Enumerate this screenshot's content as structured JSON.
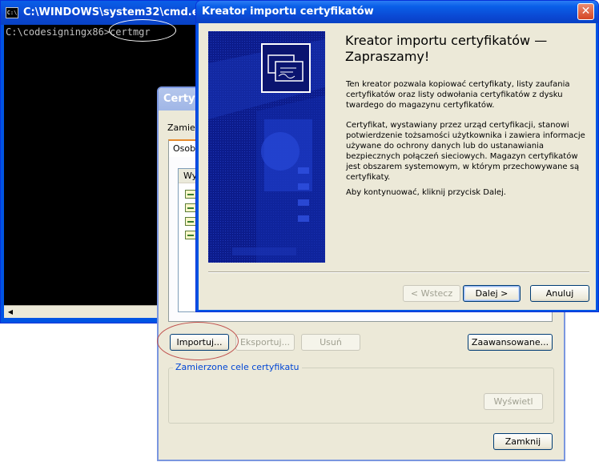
{
  "cmd": {
    "title": "C:\\WINDOWS\\system32\\cmd.exe - c",
    "icon_text": "C:\\",
    "line_prompt": "C:\\codesigningx86>",
    "line_command": "certmgr"
  },
  "certmgr": {
    "title": "Certyfi",
    "purpose_label": "Zamierz",
    "tab_label": "Osobis",
    "column_header": "Wy",
    "import_label": "Importuj...",
    "export_label": "Eksportuj...",
    "remove_label": "Usuń",
    "advanced_label": "Zaawansowane...",
    "purposes_group_label": "Zamierzone cele certyfikatu",
    "view_label": "Wyświetl",
    "close_label": "Zamknij"
  },
  "wizard": {
    "title": "Kreator importu certyfikatów",
    "close_glyph": "✕",
    "heading": "Kreator importu certyfikatów —\nZapraszamy!",
    "paragraph1": "Ten kreator pozwala kopiować certyfikaty, listy zaufania certyfikatów oraz listy odwołania certyfikatów z dysku twardego do magazynu certyfikatów.",
    "paragraph2": "Certyfikat, wystawiany przez urząd certyfikacji, stanowi potwierdzenie tożsamości użytkownika i zawiera informacje używane do ochrony danych lub do ustanawiania bezpiecznych połączeń sieciowych. Magazyn certyfikatów jest obszarem systemowym, w którym przechowywane są certyfikaty.",
    "paragraph3": "Aby kontynuować, kliknij przycisk Dalej.",
    "back_label": "< Wstecz",
    "next_label": "Dalej >",
    "cancel_label": "Anuluj"
  },
  "colors": {
    "xp_blue": "#0054e3",
    "dialog_bg": "#ece9d8",
    "banner_bg": "#0a1a8a",
    "annotation_red": "#c0504d"
  },
  "icons": [
    "cmd-icon",
    "certificate-icon",
    "close-icon",
    "certificate-wizard-icon"
  ]
}
